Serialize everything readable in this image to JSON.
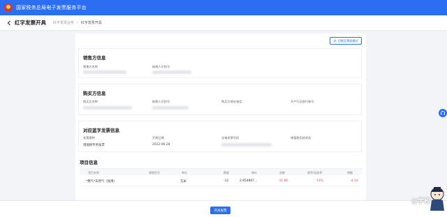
{
  "app": {
    "title": "国家税务总局电子发票服务平台"
  },
  "header": {
    "page_title": "红字发票开具",
    "breadcrumbs": [
      "红字发票业务",
      "红字发票开具"
    ]
  },
  "toolbar": {
    "switch_label": "切换至票面模式"
  },
  "seller": {
    "title": "销售方信息",
    "fields": {
      "name_label": "销售方名称",
      "tax_id_label": "纳税人识别号"
    }
  },
  "buyer": {
    "title": "购买方信息",
    "fields": {
      "name_label": "购买方名称",
      "tax_id_label": "纳税人识别号",
      "address_label": "购买方地址电话",
      "bank_label": "开户行及银行账号"
    }
  },
  "blue_invoice": {
    "title": "对应蓝字发票信息",
    "fields": {
      "type_label": "发票票种",
      "type_value": "增值税专用发票",
      "date_label": "开票日期",
      "date_value": "2022-06-28",
      "number_label": "全电发票号码",
      "usage_label": "增值税用途状态"
    }
  },
  "items": {
    "title": "项目信息",
    "columns": [
      "项目名称",
      "规格型号",
      "单位",
      "数量",
      "单价",
      "金额",
      "税率/征收率",
      "税额"
    ],
    "rows": [
      {
        "name": "*燃气*天然气（民用）",
        "spec": "",
        "unit": "方米",
        "qty": "-12",
        "price": "2.654867...",
        "amount": "-31.86",
        "rate": "13%",
        "tax": "-4.14"
      }
    ]
  },
  "footer": {
    "issue_label": "开具发票"
  },
  "help": {
    "icon": "headset-icon"
  },
  "watermark": {
    "text": "@学税"
  },
  "colors": {
    "primary": "#2c6ef2",
    "negative": "#e5484d",
    "page_bg": "#f2f4f8"
  }
}
